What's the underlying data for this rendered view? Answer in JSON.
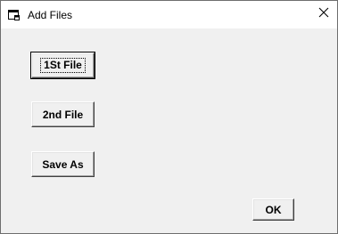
{
  "window": {
    "title": "Add Files",
    "icon": "app-window-icon",
    "close_icon": "close-icon"
  },
  "buttons": {
    "first_file": "1St File",
    "second_file": "2nd File",
    "save_as": "Save As",
    "ok": "OK"
  }
}
